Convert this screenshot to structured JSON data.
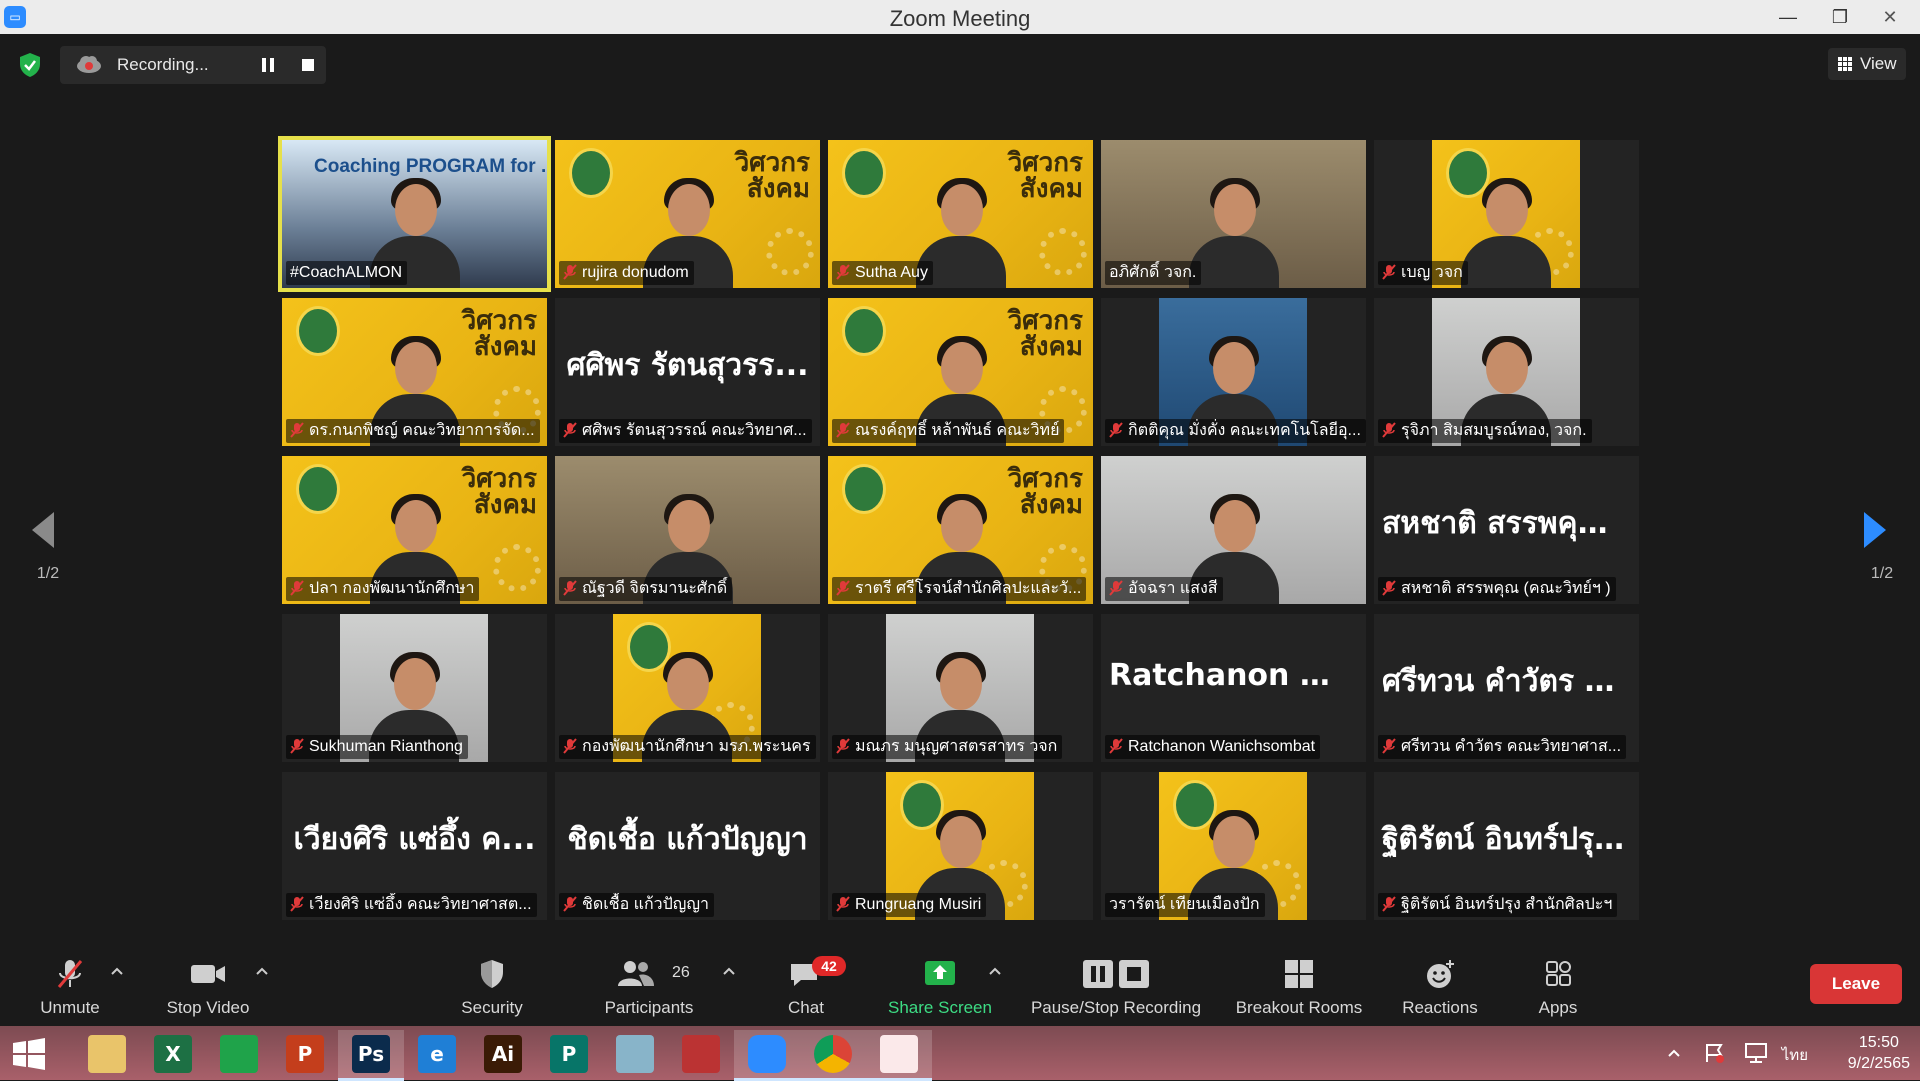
{
  "window": {
    "title": "Zoom Meeting",
    "minimize": "—",
    "restore": "❐",
    "close": "✕"
  },
  "recording": {
    "label": "Recording..."
  },
  "view_label": "View",
  "pager": {
    "left": "1/2",
    "right": "1/2"
  },
  "participants": [
    {
      "name": "#CoachALMON",
      "bg": "coach",
      "bigname": "",
      "banner": "Coaching PROGRAM for ...rer",
      "muted": false,
      "active": true
    },
    {
      "name": "rujira donudom",
      "bg": "yellow",
      "bigname": "",
      "muted": true
    },
    {
      "name": "Sutha Auy",
      "bg": "yellow",
      "bigname": "",
      "muted": true
    },
    {
      "name": "อภิศักดิ์ วจก.",
      "bg": "room",
      "bigname": "",
      "muted": false
    },
    {
      "name": "เบญ วจก",
      "bg": "yellow-inset",
      "bigname": "",
      "muted": true
    },
    {
      "name": "ดร.กนกพิชญ์ คณะวิทยาการจัด...",
      "bg": "yellow",
      "bigname": "",
      "muted": true
    },
    {
      "name": "ศศิพร รัตนสุวรรณ์ คณะวิทยาศ...",
      "bg": "dark",
      "bigname": "ศศิพร รัตนสุวรร...",
      "muted": true
    },
    {
      "name": "ณรงค์ฤทธิ์ หล้าพันธ์ คณะวิทย์",
      "bg": "yellow",
      "bigname": "",
      "muted": true
    },
    {
      "name": "กิตติคุณ มั่งคั่ง คณะเทคโนโลยีอุ...",
      "bg": "blue-inset",
      "bigname": "",
      "muted": true
    },
    {
      "name": "รุจิภา สิมสมบูรณ์ทอง, วจก.",
      "bg": "office-inset",
      "bigname": "",
      "muted": true
    },
    {
      "name": "ปลา กองพัฒนานักศึกษา",
      "bg": "yellow",
      "bigname": "",
      "muted": true
    },
    {
      "name": "ณัฐวดี จิตรมานะศักดิ์",
      "bg": "room",
      "bigname": "",
      "muted": true
    },
    {
      "name": "ราตรี ศรีโรจน์สำนักศิลปะและวั...",
      "bg": "yellow",
      "bigname": "",
      "muted": true
    },
    {
      "name": "อัจฉรา แสงสี",
      "bg": "office",
      "bigname": "",
      "muted": true
    },
    {
      "name": "สหชาติ สรรพคุณ (คณะวิทย์ฯ )",
      "bg": "dark",
      "bigname": "สหชาติ สรรพคุณ...",
      "muted": true
    },
    {
      "name": "Sukhuman Rianthong",
      "bg": "office-inset",
      "bigname": "",
      "muted": true
    },
    {
      "name": "กองพัฒนานักศึกษา มรภ.พระนคร",
      "bg": "yellow-inset",
      "bigname": "",
      "muted": true
    },
    {
      "name": "มณภร มนุญศาสตรสาทร วจก",
      "bg": "office-inset",
      "bigname": "",
      "muted": true
    },
    {
      "name": "Ratchanon Wanichsombat",
      "bg": "dark",
      "bigname": "Ratchanon Wan...",
      "muted": true
    },
    {
      "name": "ศรีทวน คำวัตร คณะวิทยาศาส...",
      "bg": "dark",
      "bigname": "ศรีทวน คำวัตร ค...",
      "muted": true
    },
    {
      "name": "เวียงศิริ แซ่อึ้ง คณะวิทยาศาสต...",
      "bg": "dark",
      "bigname": "เวียงศิริ แซ่อึ้ง ค...",
      "muted": true
    },
    {
      "name": "ชิดเชื้อ แก้วปัญญา",
      "bg": "dark",
      "bigname": "ชิดเชื้อ แก้วปัญญา",
      "muted": true
    },
    {
      "name": "Rungruang Musiri",
      "bg": "yellow-inset",
      "bigname": "",
      "muted": true
    },
    {
      "name": "วรารัตน์ เทียนเมืองปัก",
      "bg": "yellow-inset",
      "bigname": "",
      "muted": false
    },
    {
      "name": "ฐิติรัตน์ อินทร์ปรุง สำนักศิลปะฯ",
      "bg": "dark",
      "bigname": "ฐิติรัตน์ อินทร์ปรุง...",
      "muted": true
    }
  ],
  "banner_text": "วิศวกร\nสังคม",
  "toolbar": {
    "unmute": "Unmute",
    "stop_video": "Stop Video",
    "security": "Security",
    "participants": "Participants",
    "participants_count": "26",
    "chat": "Chat",
    "chat_badge": "42",
    "share_screen": "Share Screen",
    "pause_stop_recording": "Pause/Stop Recording",
    "breakout_rooms": "Breakout Rooms",
    "reactions": "Reactions",
    "apps": "Apps",
    "leave": "Leave"
  },
  "taskbar": {
    "apps": [
      {
        "name": "file-explorer",
        "glyph": "",
        "color": "#e9c46a",
        "running": false
      },
      {
        "name": "excel",
        "glyph": "X",
        "color": "#1d7044",
        "running": false
      },
      {
        "name": "store",
        "glyph": "",
        "color": "#1fa34a",
        "running": false
      },
      {
        "name": "powerpoint",
        "glyph": "P",
        "color": "#c43e1c",
        "running": false
      },
      {
        "name": "photoshop",
        "glyph": "Ps",
        "color": "#0b2b4c",
        "running": true
      },
      {
        "name": "internet-explorer",
        "glyph": "e",
        "color": "#1f7fd6",
        "running": false
      },
      {
        "name": "illustrator",
        "glyph": "Ai",
        "color": "#3b1b06",
        "running": false
      },
      {
        "name": "publisher",
        "glyph": "P",
        "color": "#077568",
        "running": false
      },
      {
        "name": "notepad",
        "glyph": "",
        "color": "#88b4c9",
        "running": false
      },
      {
        "name": "photoscape",
        "glyph": "",
        "color": "#b33",
        "running": false
      },
      {
        "name": "zoom",
        "glyph": "",
        "color": "#2d8cff",
        "running": true
      },
      {
        "name": "chrome",
        "glyph": "",
        "color": "#eaeaea",
        "running": true
      },
      {
        "name": "photos",
        "glyph": "",
        "color": "#fbe9ea",
        "running": true
      }
    ],
    "lang": "ไทย",
    "time": "15:50",
    "date": "9/2/2565"
  },
  "colors": {
    "accent_green": "#3ddc84",
    "leave_red": "#d93636",
    "active_border": "#e6e04a",
    "muted_red": "#e03a3a"
  }
}
